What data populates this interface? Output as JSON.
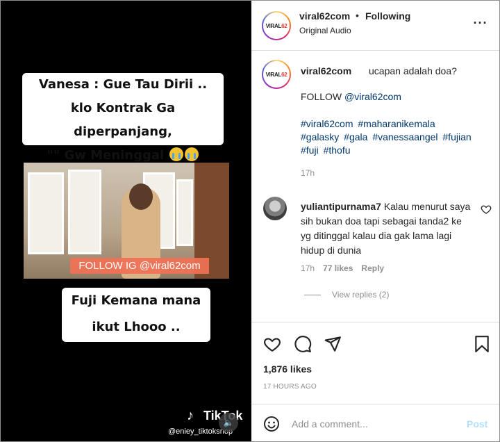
{
  "video": {
    "caption_top_line1": "Vanesa : Gue Tau Dirii ..",
    "caption_top_line2": "klo Kontrak Ga diperpanjang,",
    "caption_top_line3": "\"\" Gw Meninggal",
    "watermark": "FOLLOW IG @viral62com",
    "caption_bottom_line1": "Fuji Kemana mana",
    "caption_bottom_line2": "ikut Lhooo ..",
    "tiktok_brand": "TikTok",
    "tiktok_handle": "@eniey_tiktoksnop",
    "mute_icon": "speaker-icon"
  },
  "header": {
    "logo_text_a": "VIRAL",
    "logo_text_b": "62",
    "username": "viral62com",
    "separator": "•",
    "follow_state": "Following",
    "audio": "Original Audio",
    "more_icon": "more-horizontal-icon"
  },
  "caption": {
    "username": "viral62com",
    "text": "ucapan adalah doa?",
    "follow_prefix": "FOLLOW ",
    "follow_mention": "@viral62com",
    "hashtags": [
      "#viral62com",
      "#maharanikemala",
      "#galasky",
      "#gala",
      "#vanessaangel",
      "#fujian",
      "#fuji",
      "#thofu"
    ],
    "time": "17h"
  },
  "comment": {
    "username": "yuliantipurnama7",
    "text": "Kalau menurut saya sih bukan doa tapi sebagai tanda2 ke yg ditinggal kalau dia gak lama lagi hidup di dunia",
    "time": "17h",
    "likes": "77 likes",
    "reply_label": "Reply",
    "view_replies": "View replies (2)"
  },
  "actions": {
    "icons": [
      "heart-icon",
      "comment-icon",
      "share-icon",
      "bookmark-icon"
    ]
  },
  "post": {
    "likes": "1,876 likes",
    "ago": "17 HOURS AGO"
  },
  "comment_bar": {
    "placeholder": "Add a comment...",
    "post_label": "Post"
  },
  "colors": {
    "link": "#00376b",
    "muted": "#8e8e8e",
    "post_disabled": "#b2dffc",
    "watermark_bg": "#f17156"
  }
}
